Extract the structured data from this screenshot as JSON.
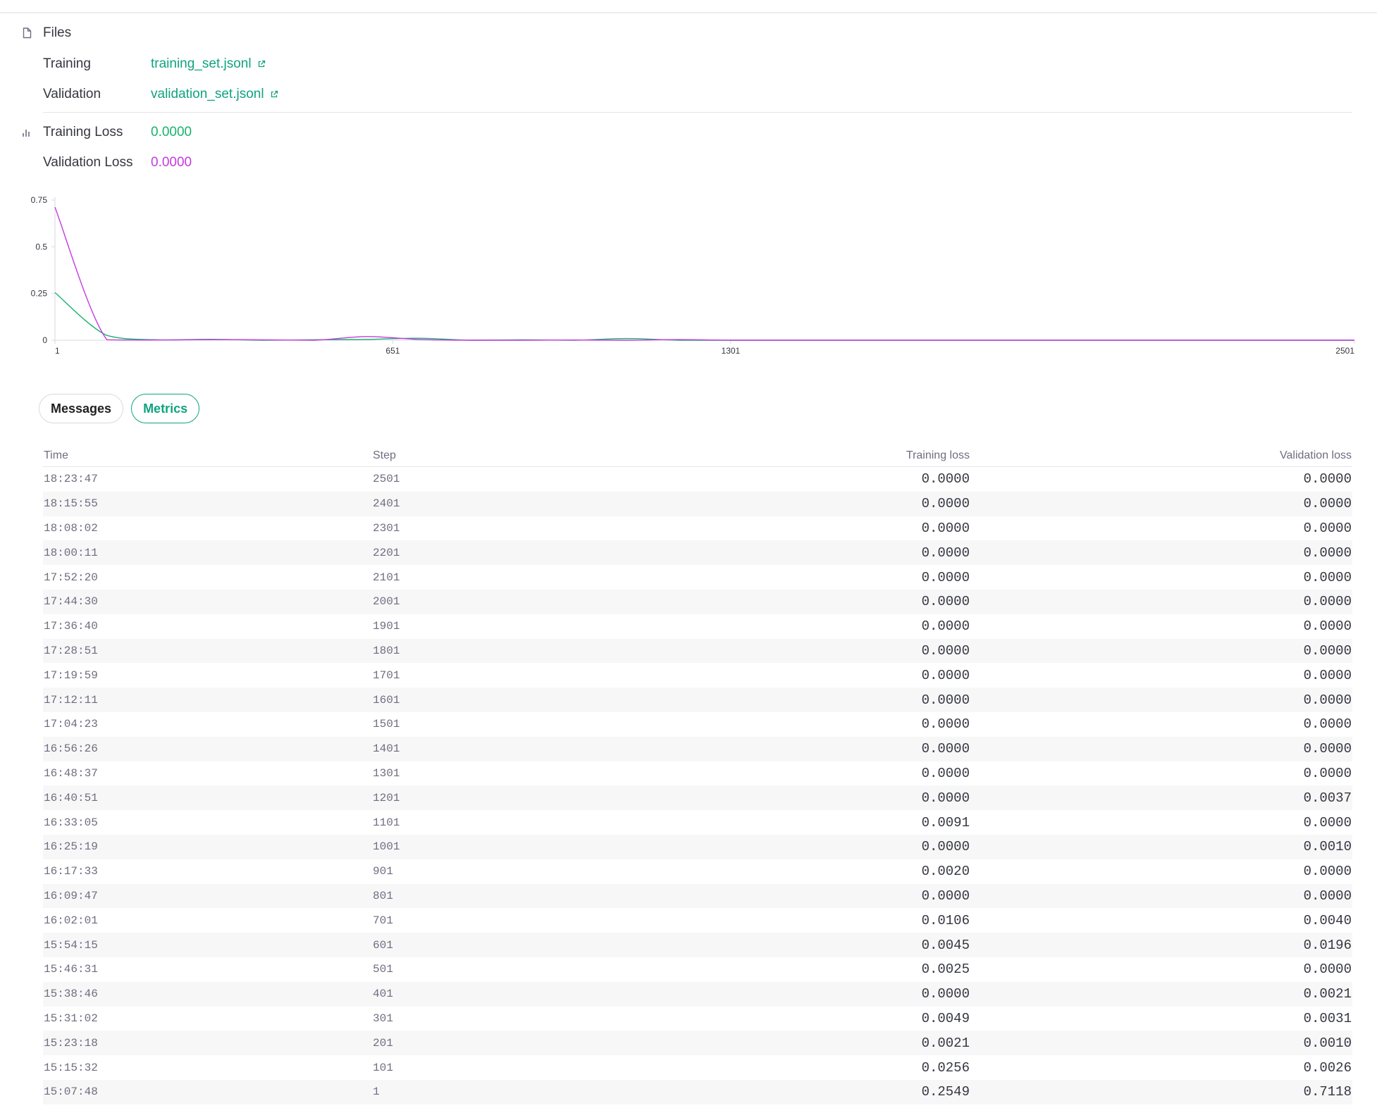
{
  "files": {
    "header": "Files",
    "training_label": "Training",
    "training_file": "training_set.jsonl",
    "validation_label": "Validation",
    "validation_file": "validation_set.jsonl"
  },
  "losses": {
    "training_label": "Training Loss",
    "training_value": "0.0000",
    "validation_label": "Validation Loss",
    "validation_value": "0.0000"
  },
  "colors": {
    "accent": "#10a37f",
    "training_series": "#19b26b",
    "validation_series": "#c53be0"
  },
  "chart_data": {
    "type": "line",
    "xlim": [
      1,
      2501
    ],
    "ylim": [
      0,
      0.75
    ],
    "x_ticks": [
      "1",
      "651",
      "1301",
      "2501"
    ],
    "y_ticks": [
      "0",
      "0.25",
      "0.5",
      "0.75"
    ],
    "grid": false,
    "legend": "none",
    "series": [
      {
        "key": "training",
        "color": "#19b26b",
        "x": [
          1,
          101,
          201,
          301,
          401,
          501,
          601,
          701,
          801,
          901,
          1001,
          1101,
          1201,
          1301,
          1401,
          1501,
          1601,
          1701,
          1801,
          1901,
          2001,
          2101,
          2201,
          2301,
          2401,
          2501
        ],
        "y": [
          0.2549,
          0.0256,
          0.0021,
          0.0049,
          0.0,
          0.0025,
          0.0045,
          0.0106,
          0.0,
          0.002,
          0.0,
          0.0091,
          0.0,
          0.0,
          0.0,
          0.0,
          0.0,
          0.0,
          0.0,
          0.0,
          0.0,
          0.0,
          0.0,
          0.0,
          0.0,
          0.0
        ]
      },
      {
        "key": "validation",
        "color": "#c53be0",
        "x": [
          1,
          101,
          201,
          301,
          401,
          501,
          601,
          701,
          801,
          901,
          1001,
          1101,
          1201,
          1301,
          1401,
          1501,
          1601,
          1701,
          1801,
          1901,
          2001,
          2101,
          2201,
          2301,
          2401,
          2501
        ],
        "y": [
          0.7118,
          0.0026,
          0.001,
          0.0031,
          0.0021,
          0.0,
          0.0196,
          0.004,
          0.0,
          0.0,
          0.001,
          0.0,
          0.0037,
          0.0,
          0.0,
          0.0,
          0.0,
          0.0,
          0.0,
          0.0,
          0.0,
          0.0,
          0.0,
          0.0,
          0.0,
          0.0
        ]
      }
    ]
  },
  "tabs": [
    {
      "label": "Messages",
      "active": false
    },
    {
      "label": "Metrics",
      "active": true
    }
  ],
  "table": {
    "headers": {
      "time": "Time",
      "step": "Step",
      "training_loss": "Training loss",
      "validation_loss": "Validation loss"
    },
    "rows": [
      {
        "time": "18:23:47",
        "step": "2501",
        "training_loss": "0.0000",
        "validation_loss": "0.0000"
      },
      {
        "time": "18:15:55",
        "step": "2401",
        "training_loss": "0.0000",
        "validation_loss": "0.0000"
      },
      {
        "time": "18:08:02",
        "step": "2301",
        "training_loss": "0.0000",
        "validation_loss": "0.0000"
      },
      {
        "time": "18:00:11",
        "step": "2201",
        "training_loss": "0.0000",
        "validation_loss": "0.0000"
      },
      {
        "time": "17:52:20",
        "step": "2101",
        "training_loss": "0.0000",
        "validation_loss": "0.0000"
      },
      {
        "time": "17:44:30",
        "step": "2001",
        "training_loss": "0.0000",
        "validation_loss": "0.0000"
      },
      {
        "time": "17:36:40",
        "step": "1901",
        "training_loss": "0.0000",
        "validation_loss": "0.0000"
      },
      {
        "time": "17:28:51",
        "step": "1801",
        "training_loss": "0.0000",
        "validation_loss": "0.0000"
      },
      {
        "time": "17:19:59",
        "step": "1701",
        "training_loss": "0.0000",
        "validation_loss": "0.0000"
      },
      {
        "time": "17:12:11",
        "step": "1601",
        "training_loss": "0.0000",
        "validation_loss": "0.0000"
      },
      {
        "time": "17:04:23",
        "step": "1501",
        "training_loss": "0.0000",
        "validation_loss": "0.0000"
      },
      {
        "time": "16:56:26",
        "step": "1401",
        "training_loss": "0.0000",
        "validation_loss": "0.0000"
      },
      {
        "time": "16:48:37",
        "step": "1301",
        "training_loss": "0.0000",
        "validation_loss": "0.0000"
      },
      {
        "time": "16:40:51",
        "step": "1201",
        "training_loss": "0.0000",
        "validation_loss": "0.0037"
      },
      {
        "time": "16:33:05",
        "step": "1101",
        "training_loss": "0.0091",
        "validation_loss": "0.0000"
      },
      {
        "time": "16:25:19",
        "step": "1001",
        "training_loss": "0.0000",
        "validation_loss": "0.0010"
      },
      {
        "time": "16:17:33",
        "step": "901",
        "training_loss": "0.0020",
        "validation_loss": "0.0000"
      },
      {
        "time": "16:09:47",
        "step": "801",
        "training_loss": "0.0000",
        "validation_loss": "0.0000"
      },
      {
        "time": "16:02:01",
        "step": "701",
        "training_loss": "0.0106",
        "validation_loss": "0.0040"
      },
      {
        "time": "15:54:15",
        "step": "601",
        "training_loss": "0.0045",
        "validation_loss": "0.0196"
      },
      {
        "time": "15:46:31",
        "step": "501",
        "training_loss": "0.0025",
        "validation_loss": "0.0000"
      },
      {
        "time": "15:38:46",
        "step": "401",
        "training_loss": "0.0000",
        "validation_loss": "0.0021"
      },
      {
        "time": "15:31:02",
        "step": "301",
        "training_loss": "0.0049",
        "validation_loss": "0.0031"
      },
      {
        "time": "15:23:18",
        "step": "201",
        "training_loss": "0.0021",
        "validation_loss": "0.0010"
      },
      {
        "time": "15:15:32",
        "step": "101",
        "training_loss": "0.0256",
        "validation_loss": "0.0026"
      },
      {
        "time": "15:07:48",
        "step": "1",
        "training_loss": "0.2549",
        "validation_loss": "0.7118"
      }
    ]
  }
}
